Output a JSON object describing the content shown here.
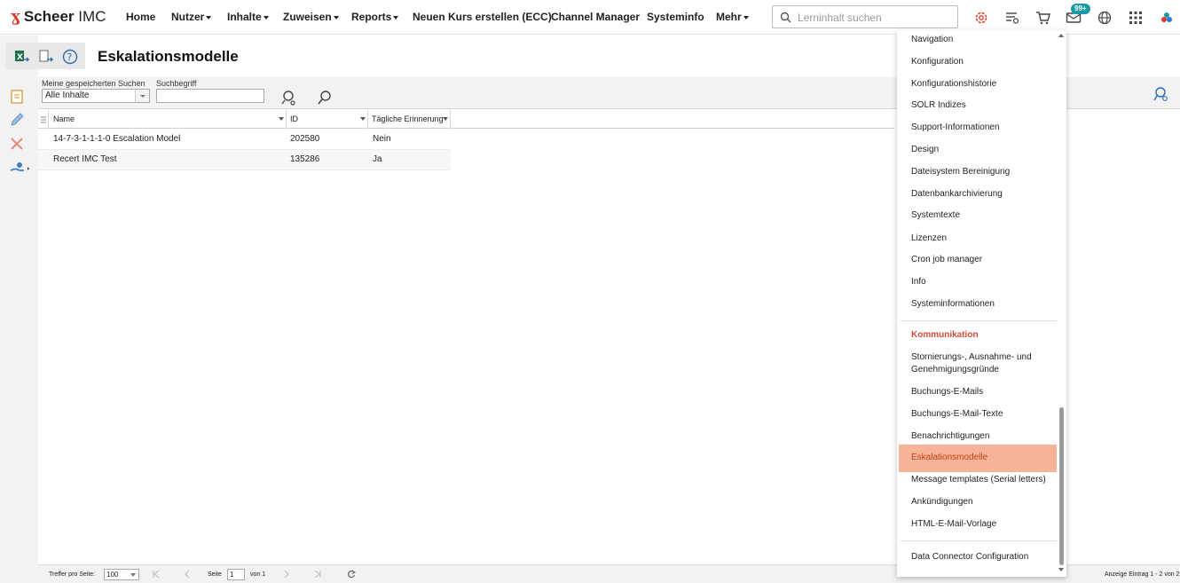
{
  "brand": {
    "name_bold": "Scheer",
    "name_light": " IMC"
  },
  "nav": {
    "items": [
      {
        "label": "Home",
        "has_menu": false
      },
      {
        "label": "Nutzer",
        "has_menu": true
      },
      {
        "label": "Inhalte",
        "has_menu": true
      },
      {
        "label": "Zuweisen",
        "has_menu": true
      },
      {
        "label": "Reports",
        "has_menu": true
      },
      {
        "label": "Neuen Kurs erstellen (ECC)",
        "has_menu": false
      },
      {
        "label": "Channel Manager",
        "has_menu": false
      },
      {
        "label": "Systeminfo",
        "has_menu": false
      },
      {
        "label": "Mehr",
        "has_menu": true
      }
    ],
    "search_placeholder": "Lerninhalt suchen",
    "notification_badge": "99+"
  },
  "page": {
    "title": "Eskalationsmodelle"
  },
  "filters": {
    "saved_search_label": "Meine gespeicherten Suchen",
    "saved_search_value": "Alle Inhalte",
    "term_label": "Suchbegriff",
    "term_value": ""
  },
  "grid": {
    "columns": [
      "Name",
      "ID",
      "Tägliche Erinnerung"
    ],
    "rows": [
      [
        "14-7-3-1-1-1-0 Escalation Model",
        "202580",
        "Nein"
      ],
      [
        "Recert IMC Test",
        "135286",
        "Ja"
      ]
    ]
  },
  "footer": {
    "per_page_label": "Treffer pro Seite:",
    "per_page_value": "100",
    "page_label": "Seite",
    "page_value": "1",
    "of_label": "von 1",
    "display_info": "Anzeige Eintrag 1 - 2 von 2"
  },
  "menu": {
    "items_top": [
      "Navigation",
      "Konfiguration",
      "Konfigurationshistorie",
      "SOLR Indizes",
      "Support-Informationen",
      "Design",
      "Dateisystem Bereinigung",
      "Datenbankarchivierung",
      "Systemtexte",
      "Lizenzen",
      "Cron job manager",
      "Info",
      "Systeminformationen"
    ],
    "section_title": "Kommunikation",
    "items_comm_first_line1": "Stornierungs-, Ausnahme- und",
    "items_comm_first_line2": "Genehmigungsgründe",
    "items_comm": [
      "Buchungs-E-Mails",
      "Buchungs-E-Mail-Texte",
      "Benachrichtigungen",
      "Eskalationsmodelle",
      "Message templates (Serial letters)",
      "Ankündigungen",
      "HTML-E-Mail-Vorlage"
    ],
    "active_item": "Eskalationsmodelle",
    "item_bottom": "Data Connector Configuration"
  },
  "colors": {
    "accent": "#d9372b",
    "active_menu_bg": "#f5b397",
    "badge": "#1a9aa3",
    "section": "#d24a3a"
  }
}
